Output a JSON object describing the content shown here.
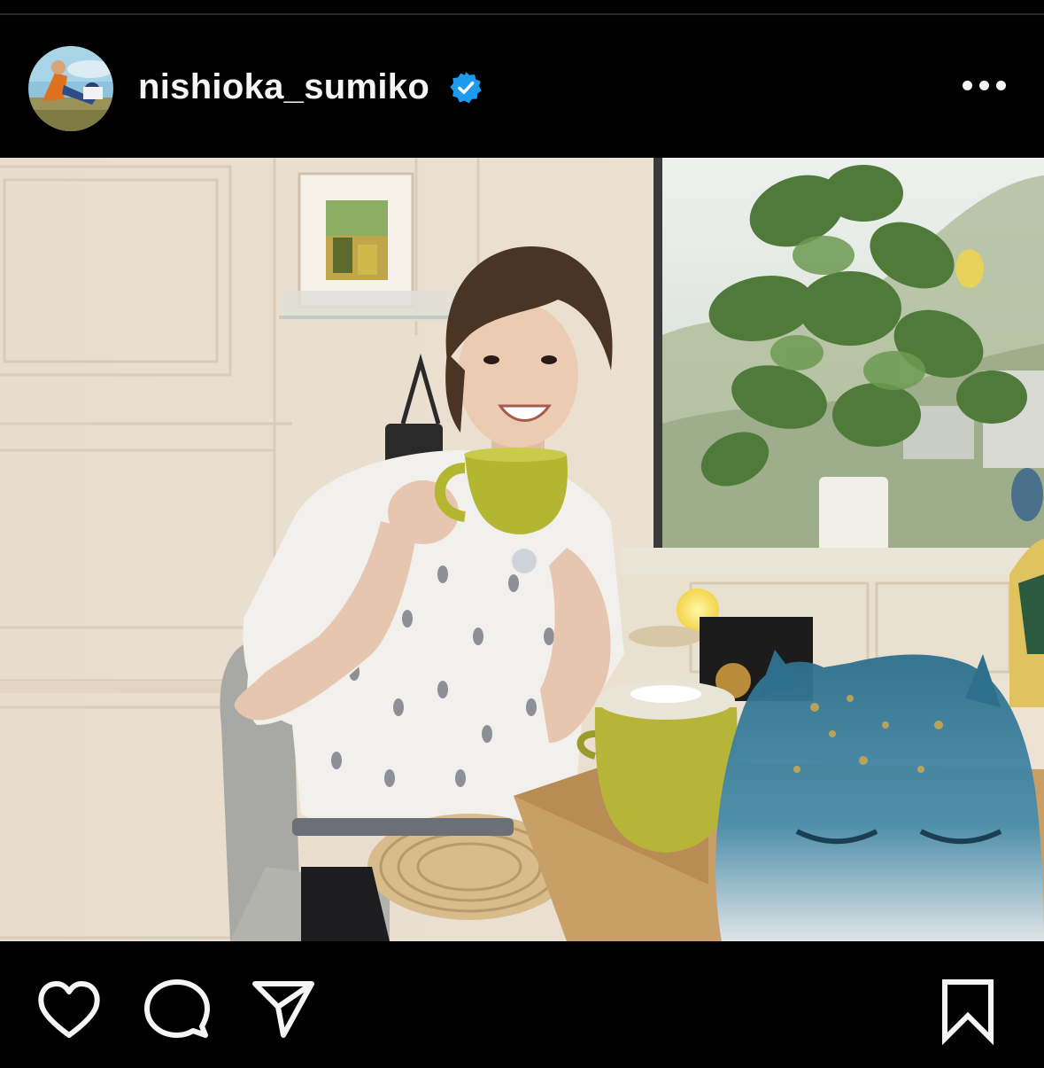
{
  "post": {
    "username": "nishioka_sumiko",
    "verified": true,
    "avatar_icon": "avatar-photo",
    "menu_icon": "more-options-icon"
  },
  "actions": {
    "like_icon": "heart-icon",
    "comment_icon": "comment-icon",
    "share_icon": "paper-plane-icon",
    "save_icon": "bookmark-icon"
  },
  "colors": {
    "background": "#000000",
    "text": "#f5f5f5",
    "verified_badge": "#1d9bf0"
  }
}
